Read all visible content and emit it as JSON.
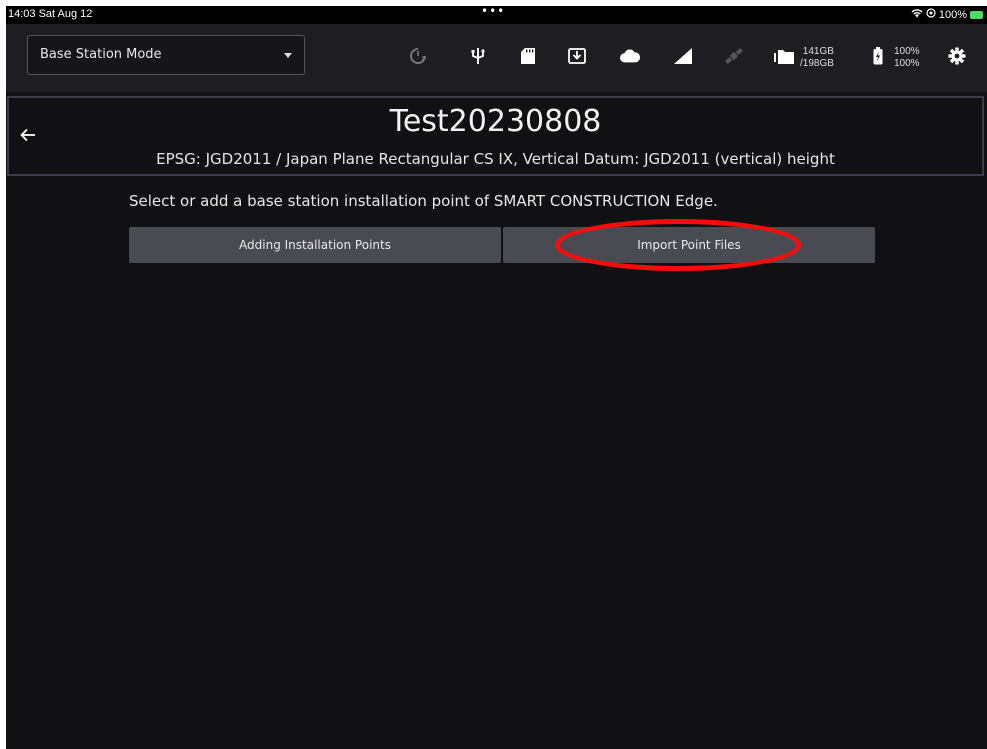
{
  "status_bar": {
    "time": "14:03  Sat Aug 12",
    "dots": "•••",
    "battery_percent": "100%"
  },
  "toolbar": {
    "mode_select_value": "Base Station Mode",
    "icons": [
      "refresh-timer-icon",
      "usb-icon",
      "sd-card-icon",
      "download-box-icon",
      "cloud-icon",
      "signal-icon",
      "satellite-icon",
      "folder-icon",
      "battery-icon",
      "gear-icon"
    ],
    "storage_used": "141GB",
    "storage_total": "/198GB",
    "battery_a": "100%",
    "battery_b": "100%"
  },
  "header": {
    "title": "Test20230808",
    "subtitle": "EPSG: JGD2011 / Japan Plane Rectangular CS IX, Vertical Datum: JGD2011 (vertical) height"
  },
  "main": {
    "instruction": "Select or add a base station installation point of SMART CONSTRUCTION Edge.",
    "add_button_label": "Adding Installation Points",
    "import_button_label": "Import Point Files"
  },
  "colors": {
    "background": "#111114",
    "toolbar": "#1e1e22",
    "button": "#4a4a52",
    "annotation": "#ff0a0a"
  }
}
